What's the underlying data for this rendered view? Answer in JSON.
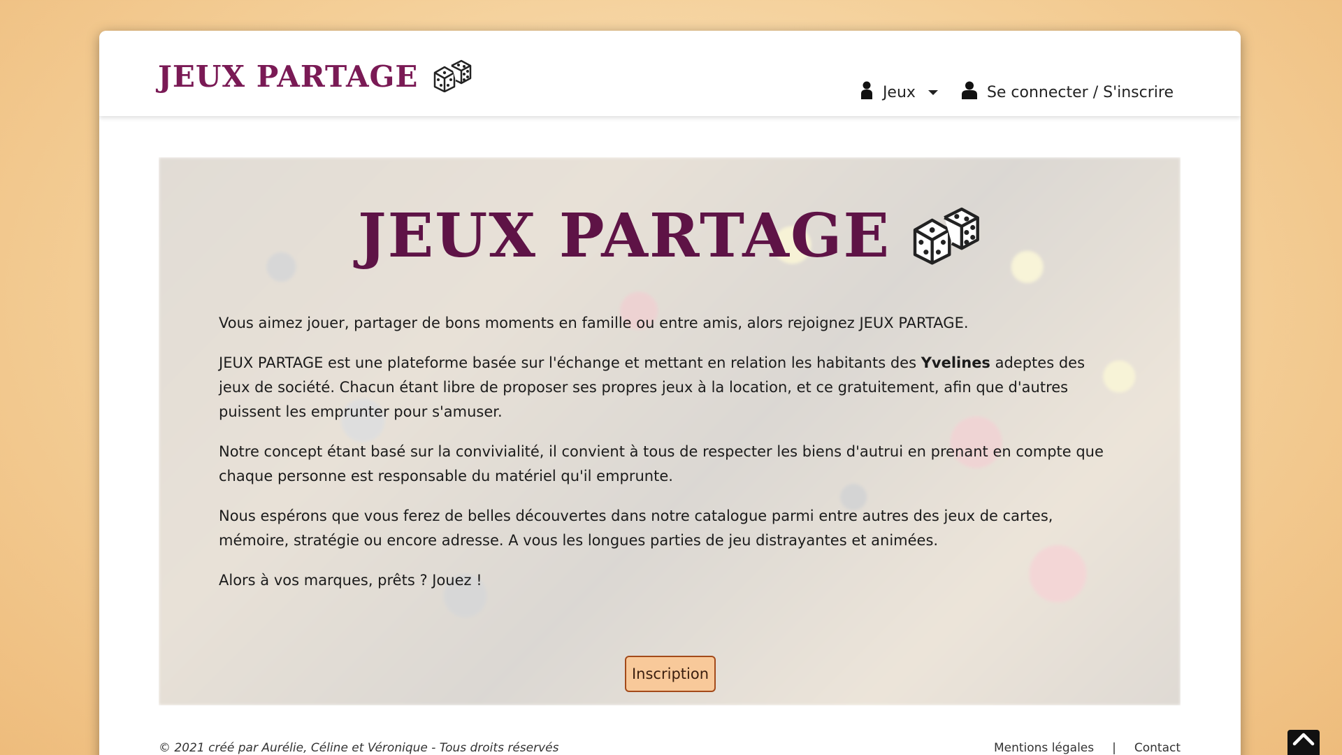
{
  "brand": {
    "name": "JEUX PARTAGE",
    "logo_icon": "dice-icon",
    "color": "#7a1a55"
  },
  "nav": {
    "games_label": "Jeux",
    "login_label": "Se connecter / S'inscrire",
    "games_icon": "user-icon",
    "login_icon": "user-icon"
  },
  "hero": {
    "title": "JEUX PARTAGE",
    "paragraphs": {
      "p1": "Vous aimez jouer, partager de bons moments en famille ou entre amis, alors rejoignez JEUX PARTAGE.",
      "p2_before": "JEUX PARTAGE est une plateforme basée sur l'échange et mettant en relation les habitants des ",
      "p2_bold": "Yvelines",
      "p2_after": " adeptes des jeux de société. Chacun étant libre de proposer ses propres jeux à la location, et ce gratuitement, afin que d'autres puissent les emprunter pour s'amuser.",
      "p3": "Notre concept étant basé sur la convivialité, il convient à tous de respecter les biens d'autrui en prenant en compte que chaque personne est responsable du matériel qu'il emprunte.",
      "p4": "Nous espérons que vous ferez de belles découvertes dans notre catalogue parmi entre autres des jeux de cartes, mémoire, stratégie ou encore adresse. A vous les longues parties de jeu distrayantes et animées.",
      "p5": "Alors à vos marques, prêts ? Jouez !"
    },
    "button_label": "Inscription",
    "button_color": "#f8c99a"
  },
  "footer": {
    "copyright": "© 2021 créé par Aurélie, Céline et Véronique - Tous droits réservés",
    "legal_label": "Mentions légales",
    "separator": "|",
    "contact_label": "Contact"
  },
  "back_to_top_icon": "chevron-up-icon"
}
